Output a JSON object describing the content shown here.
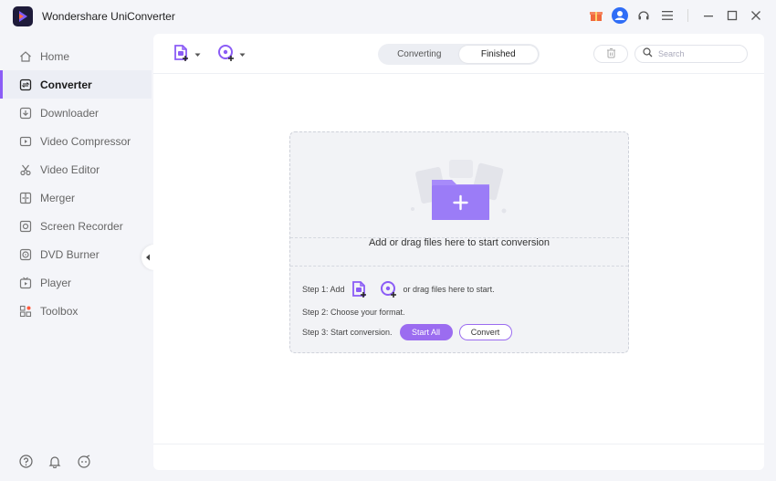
{
  "app": {
    "title": "Wondershare UniConverter"
  },
  "sidebar": {
    "items": [
      {
        "label": "Home",
        "icon": "home-icon"
      },
      {
        "label": "Converter",
        "icon": "converter-icon",
        "active": true
      },
      {
        "label": "Downloader",
        "icon": "download-icon"
      },
      {
        "label": "Video Compressor",
        "icon": "compress-icon"
      },
      {
        "label": "Video Editor",
        "icon": "scissors-icon"
      },
      {
        "label": "Merger",
        "icon": "merge-icon"
      },
      {
        "label": "Screen Recorder",
        "icon": "record-icon"
      },
      {
        "label": "DVD Burner",
        "icon": "disc-icon"
      },
      {
        "label": "Player",
        "icon": "play-icon"
      },
      {
        "label": "Toolbox",
        "icon": "grid-icon"
      }
    ]
  },
  "toolbar": {
    "tabs": [
      "Converting",
      "Finished"
    ],
    "active_tab": "Finished",
    "search_placeholder": "Search"
  },
  "dropzone": {
    "prompt": "Add or drag files here to start conversion",
    "step1_prefix": "Step 1: Add",
    "step1_suffix": "or drag files here to start.",
    "step2": "Step 2: Choose your format.",
    "step3": "Step 3: Start conversion.",
    "start_all_label": "Start All",
    "convert_label": "Convert"
  },
  "colors": {
    "accent": "#8b5cf6",
    "button": "#9b6cf0"
  }
}
